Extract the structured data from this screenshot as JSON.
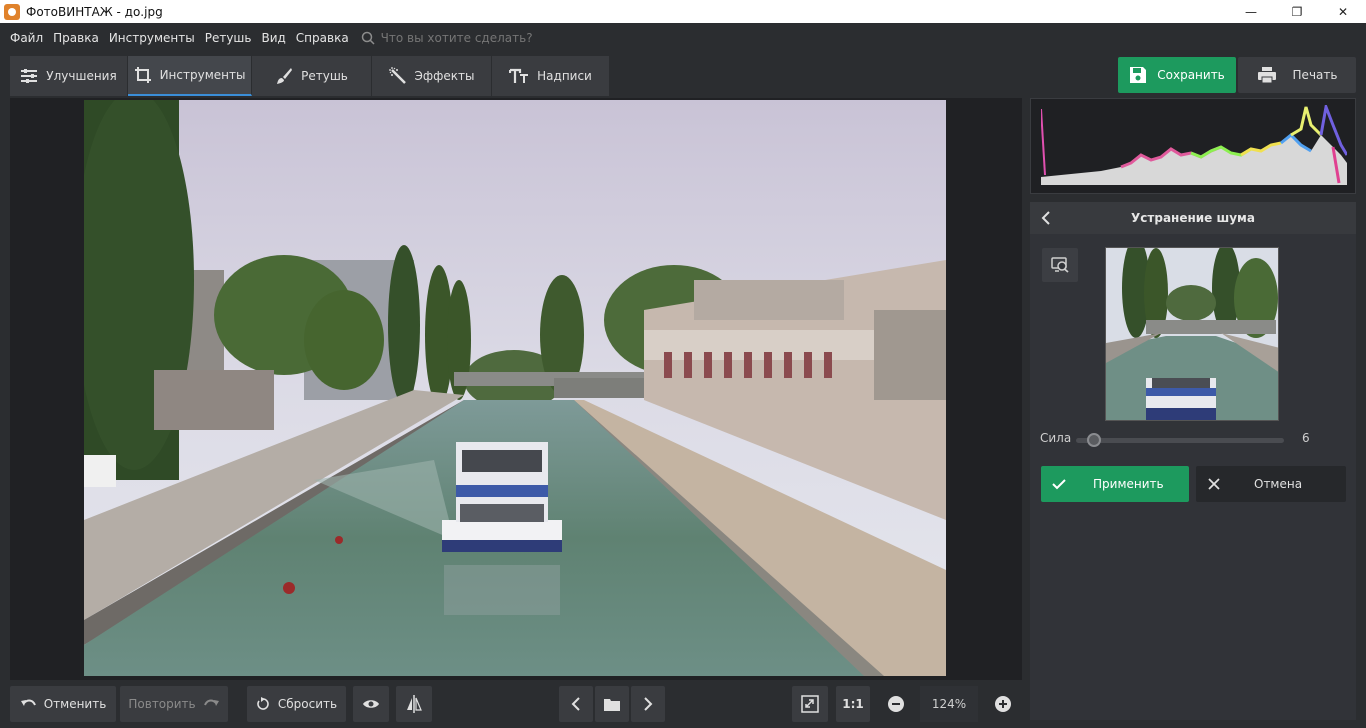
{
  "window": {
    "title": "ФотоВИНТАЖ - до.jpg",
    "minimize": "—",
    "maximize": "❐",
    "close": "✕"
  },
  "menu": {
    "items": [
      "Файл",
      "Правка",
      "Инструменты",
      "Ретушь",
      "Вид",
      "Справка"
    ],
    "search_placeholder": "Что вы хотите сделать?"
  },
  "tabs": [
    {
      "label": "Улучшения",
      "icon": "sliders-icon"
    },
    {
      "label": "Инструменты",
      "icon": "crop-icon",
      "active": true
    },
    {
      "label": "Ретушь",
      "icon": "brush-icon"
    },
    {
      "label": "Эффекты",
      "icon": "magic-wand-icon"
    },
    {
      "label": "Надписи",
      "icon": "text-icon"
    }
  ],
  "toolbar": {
    "save_label": "Сохранить",
    "print_label": "Печать"
  },
  "panel": {
    "title": "Устранение шума",
    "slider_label": "Сила",
    "slider_value": "6",
    "apply_label": "Применить",
    "cancel_label": "Отмена"
  },
  "bottom": {
    "undo_label": "Отменить",
    "redo_label": "Повторить",
    "reset_label": "Сбросить",
    "ratio_label": "1:1",
    "zoom_value": "124%"
  },
  "colors": {
    "accent_green": "#1d9a5e",
    "active_tab_underline": "#3b8fd9",
    "background": "#2b2d30"
  }
}
